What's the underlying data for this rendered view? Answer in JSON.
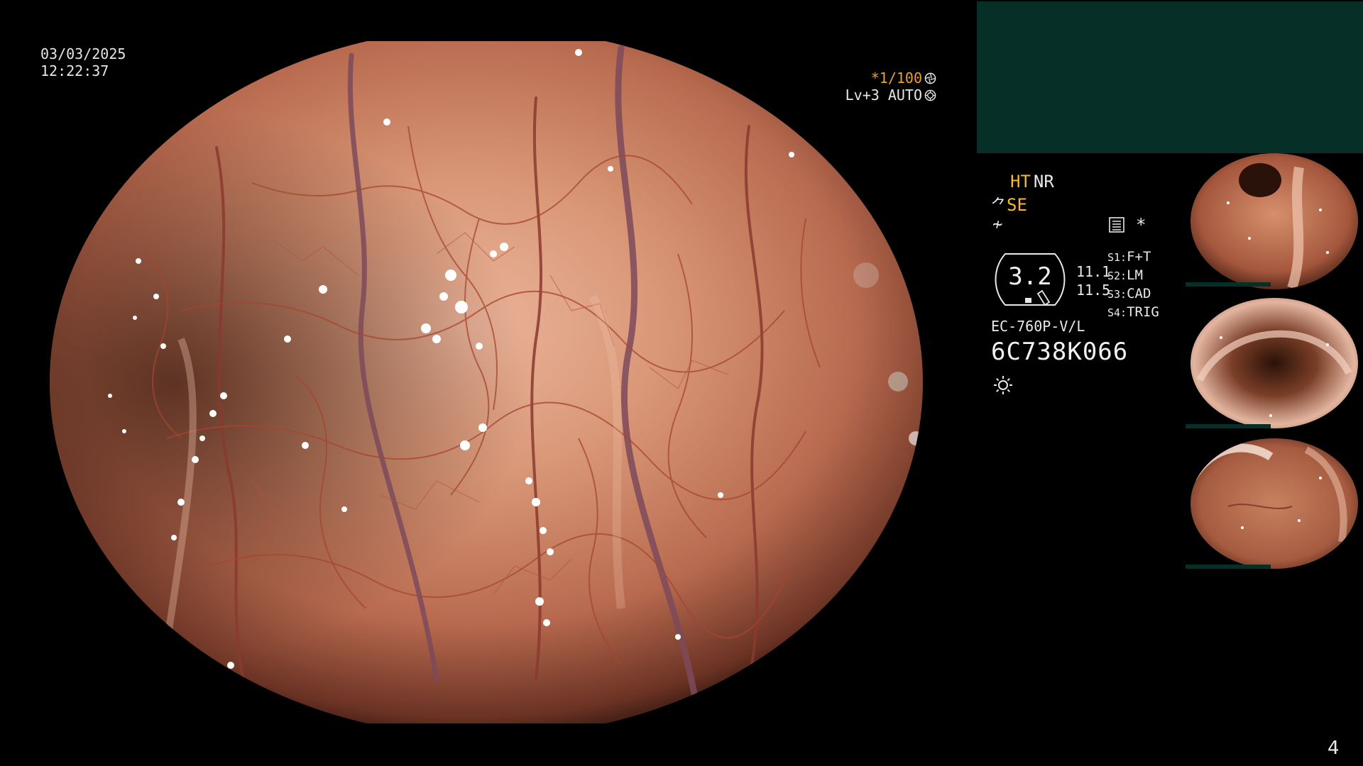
{
  "overlay": {
    "date": "03/03/2025",
    "time": "12:22:37",
    "shutter_speed": "*1/100",
    "brightness_mode": "Lv+3 AUTO",
    "iris_icon": "shutter-icon",
    "mode_icon": "iris-icon"
  },
  "image_modes": {
    "ht": "HT",
    "nr": "NR",
    "se": "SE",
    "f_icon": "f-mark-icon",
    "star": "*"
  },
  "zoom": {
    "value": "3.2",
    "readout_1": "11.1",
    "readout_2": "11.5"
  },
  "switches": [
    {
      "key": "S1:",
      "value": "F+T"
    },
    {
      "key": "S2:",
      "value": "LM"
    },
    {
      "key": "S3:",
      "value": "CAD"
    },
    {
      "key": "S4:",
      "value": "TRIG"
    }
  ],
  "scope": {
    "model": "EC-760P-V/L",
    "serial": "6C738K066"
  },
  "colors": {
    "amber": "#e8a336",
    "yellow": "#f5b82e",
    "panel_green": "#062f28",
    "tissue": "#c98467",
    "vessel": "#9b3a2a"
  },
  "page_number": "4"
}
